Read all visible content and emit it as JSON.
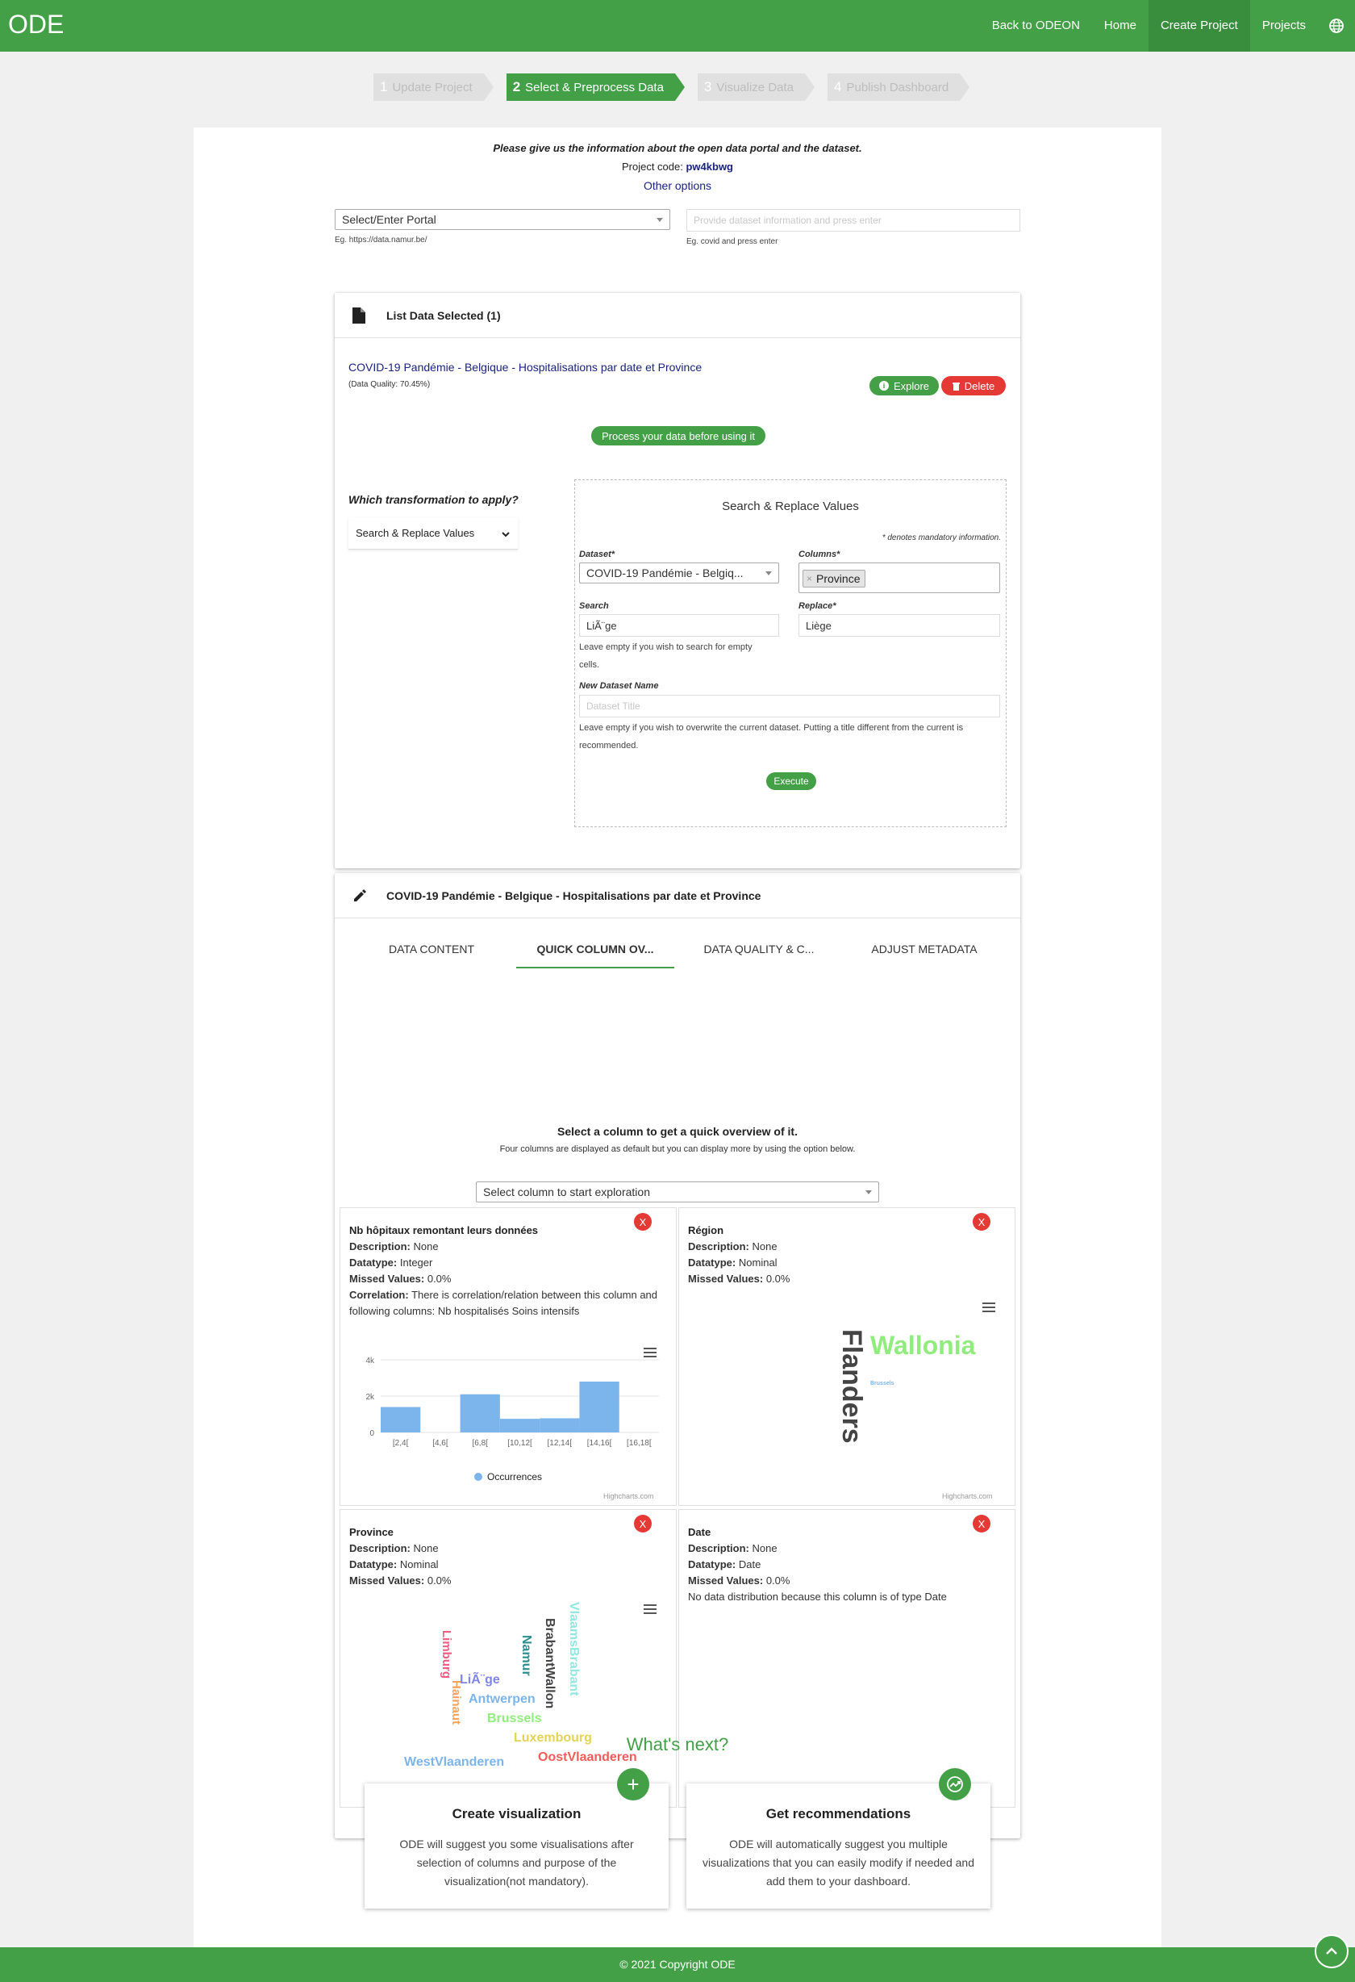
{
  "nav": {
    "brand": "ODE",
    "links": [
      "Back to ODEON",
      "Home",
      "Create Project",
      "Projects"
    ],
    "active_index": 2
  },
  "steps": [
    {
      "num": "1",
      "label": "Update Project"
    },
    {
      "num": "2",
      "label": "Select & Preprocess Data"
    },
    {
      "num": "3",
      "label": "Visualize Data"
    },
    {
      "num": "4",
      "label": "Publish Dashboard"
    }
  ],
  "intro": {
    "heading": "Please give us the information about the open data portal and the dataset.",
    "project_code_label": "Project code:",
    "project_code": "pw4kbwg",
    "other_options": "Other options"
  },
  "portal": {
    "select_value": "Select/Enter Portal",
    "hint": "Eg. https://data.namur.be/",
    "dataset_placeholder": "Provide dataset information and press enter",
    "dataset_hint": "Eg. covid and press enter"
  },
  "list_card": {
    "title": "List Data Selected (1)",
    "dataset_title": "COVID-19 Pandémie - Belgique - Hospitalisations par date et Province",
    "quality": "(Data Quality: 70.45%)",
    "explore": "Explore",
    "delete": "Delete",
    "process_badge": "Process your data before using it",
    "transform_question": "Which transformation to apply?",
    "transform_value": "Search & Replace Values"
  },
  "sr_form": {
    "title": "Search & Replace Values",
    "mandatory_note": "* denotes mandatory information.",
    "dataset_label": "Dataset*",
    "dataset_value": "COVID-19 Pandémie - Belgiq...",
    "columns_label": "Columns*",
    "column_chip": "Province",
    "search_label": "Search",
    "search_value": "LiÃ¨ge",
    "search_help": "Leave empty if you wish to search for empty cells.",
    "replace_label": "Replace*",
    "replace_value": "Liège",
    "new_name_label": "New Dataset Name",
    "new_name_placeholder": "Dataset Title",
    "new_name_help": "Leave empty if you wish to overwrite the current dataset. Putting a title different from the current is recommended.",
    "execute": "Execute"
  },
  "detail_card": {
    "title": "COVID-19 Pandémie - Belgique - Hospitalisations par date et Province",
    "tabs": [
      "DATA CONTENT",
      "QUICK COLUMN OV...",
      "DATA QUALITY & C...",
      "ADJUST METADATA"
    ],
    "active_tab": 1,
    "overview_heading": "Select a column to get a quick overview of it.",
    "overview_sub": "Four columns are displayed as default but you can display more by using the option below.",
    "column_select": "Select column to start exploration"
  },
  "panels": {
    "p1": {
      "title": "Nb hôpitaux remontant leurs données",
      "description": "None",
      "datatype": "Integer",
      "missed": "0.0%",
      "correlation": "There is correlation/relation between this column and following columns: Nb hospitalisés Soins intensifs",
      "legend": "Occurrences"
    },
    "p2": {
      "title": "Région",
      "description": "None",
      "datatype": "Nominal",
      "missed": "0.0%"
    },
    "p3": {
      "title": "Province",
      "description": "None",
      "datatype": "Nominal",
      "missed": "0.0%"
    },
    "p4": {
      "title": "Date",
      "description": "None",
      "datatype": "Date",
      "missed": "0.0%",
      "note": "No data distribution because this column is of type Date"
    },
    "labels": {
      "description": "Description:",
      "datatype": "Datatype:",
      "missed": "Missed Values:",
      "correlation": "Correlation:"
    },
    "close": "X",
    "credit": "Highcharts.com"
  },
  "chart_data": {
    "type": "bar",
    "categories": [
      "[2,4[",
      "[4,6[",
      "[6,8[",
      "[10,12[",
      "[12,14[",
      "[14,16[",
      "[16,18["
    ],
    "series": [
      {
        "name": "Occurrences",
        "values": [
          1400,
          0,
          2100,
          750,
          780,
          2800,
          0
        ]
      }
    ],
    "ylim": [
      0,
      4000
    ],
    "yticks": [
      "0",
      "2k",
      "4k"
    ],
    "color": "#7cb5ec"
  },
  "wordclouds": {
    "region": [
      "Flanders",
      "Wallonia",
      "Brussels"
    ],
    "province": [
      "WestVlaanderen",
      "OostVlaanderen",
      "Luxembourg",
      "Brussels",
      "Antwerpen",
      "LiÃ¨ge",
      "Limburg",
      "Hainaut",
      "Namur",
      "BrabantWallon",
      "VlaamsBrabant"
    ]
  },
  "next": {
    "heading": "What's next?",
    "cards": [
      {
        "title": "Create visualization",
        "text": "ODE will suggest you some visualisations after selection of columns and purpose of the visualization(not mandatory)."
      },
      {
        "title": "Get recommendations",
        "text": "ODE will automatically suggest you multiple visualizations that you can easily modify if needed and add them to your dashboard."
      }
    ]
  },
  "footer": "© 2021 Copyright ODE",
  "colors": {
    "primary": "#43a047",
    "danger": "#e53935",
    "link": "#1a237e"
  }
}
